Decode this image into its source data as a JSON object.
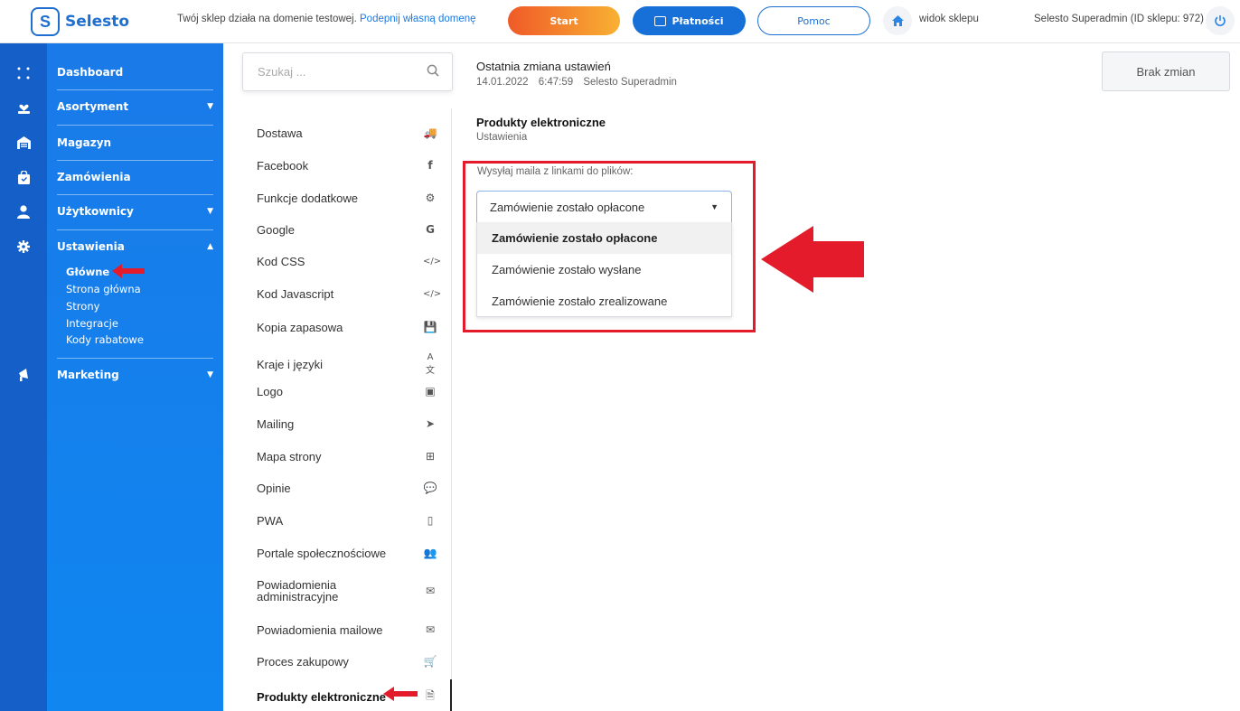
{
  "topbar": {
    "logo_text": "Selesto",
    "domain_text": "Twój sklep działa na domenie testowej.",
    "domain_link": "Podepnij własną domenę",
    "start_label": "Start",
    "payments_label": "Płatności",
    "help_label": "Pomoc",
    "shop_view_label": "widok sklepu",
    "admin_label": "Selesto Superadmin (ID sklepu: 972)"
  },
  "nav": {
    "items": [
      {
        "label": "Dashboard",
        "icon": "grid-icon"
      },
      {
        "label": "Asortyment",
        "icon": "hand-heart-icon",
        "caret": "▼"
      },
      {
        "label": "Magazyn",
        "icon": "warehouse-icon"
      },
      {
        "label": "Zamówienia",
        "icon": "shopping-bag-icon"
      },
      {
        "label": "Użytkownicy",
        "icon": "user-icon",
        "caret": "▼"
      },
      {
        "label": "Ustawienia",
        "icon": "gear-icon",
        "caret": "▲"
      },
      {
        "label": "Marketing",
        "icon": "megaphone-icon",
        "caret": "▼"
      }
    ],
    "sub_items": [
      "Główne",
      "Strona główna",
      "Strony",
      "Integracje",
      "Kody rabatowe"
    ]
  },
  "search": {
    "placeholder": "Szukaj ..."
  },
  "settings_list": [
    {
      "label": "Dostawa",
      "icon": "truck-icon"
    },
    {
      "label": "Facebook",
      "icon": "facebook-icon"
    },
    {
      "label": "Funkcje dodatkowe",
      "icon": "cogs-icon"
    },
    {
      "label": "Google",
      "icon": "google-icon"
    },
    {
      "label": "Kod CSS",
      "icon": "code-icon"
    },
    {
      "label": "Kod Javascript",
      "icon": "code-icon"
    },
    {
      "label": "Kopia zapasowa",
      "icon": "floppy-disk-icon"
    },
    {
      "label": "Kraje i języki",
      "icon": "language-icon"
    },
    {
      "label": "Logo",
      "icon": "image-icon"
    },
    {
      "label": "Mailing",
      "icon": "paper-plane-icon"
    },
    {
      "label": "Mapa strony",
      "icon": "sitemap-icon"
    },
    {
      "label": "Opinie",
      "icon": "comments-icon"
    },
    {
      "label": "PWA",
      "icon": "mobile-icon"
    },
    {
      "label": "Portale społecznościowe",
      "icon": "users-icon"
    },
    {
      "label": "Powiadomienia administracyjne",
      "icon": "envelope-icon"
    },
    {
      "label": "Powiadomienia mailowe",
      "icon": "envelope-icon"
    },
    {
      "label": "Proces zakupowy",
      "icon": "cart-icon"
    },
    {
      "label": "Produkty elektroniczne",
      "icon": "file-icon"
    }
  ],
  "last_change": {
    "title": "Ostatnia zmiana ustawień",
    "date": "14.01.2022",
    "time": "6:47:59",
    "user": "Selesto Superadmin"
  },
  "no_changes_label": "Brak zmian",
  "section": {
    "title": "Produkty elektroniczne",
    "subtitle": "Ustawienia"
  },
  "field": {
    "label": "Wysyłaj maila z linkami do plików:",
    "value": "Zamówienie zostało opłacone",
    "options": [
      "Zamówienie zostało opłacone",
      "Zamówienie zostało wysłane",
      "Zamówienie zostało zrealizowane"
    ]
  },
  "colors": {
    "accent": "#1670d8",
    "highlight_red": "#e41b2a",
    "nav_blue": "#1a7ae8"
  }
}
